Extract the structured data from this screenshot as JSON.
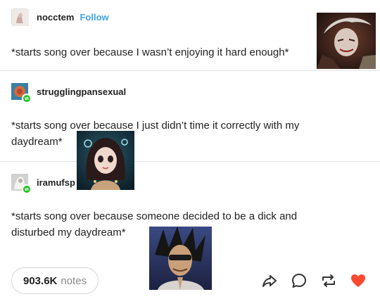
{
  "posts": [
    {
      "username": "nocctem",
      "follow_label": "Follow",
      "text": "*starts song over because I wasn’t enjoying it hard enough*"
    },
    {
      "username": "strugglingpansexual",
      "text": "*starts song over because I just didn’t time it correctly with my daydream*"
    },
    {
      "username": "iramufsp",
      "text": "*starts song over because someone decided to be a dick and disturbed my daydream*"
    }
  ],
  "footer": {
    "notes_count": "903.6K",
    "notes_label": "notes"
  },
  "colors": {
    "follow": "#3fa3e8",
    "reblog_badge": "#1ec31e",
    "heart": "#ff4930",
    "icon": "#333333"
  },
  "icons": [
    "share-icon",
    "reply-icon",
    "reblog-icon",
    "like-heart-icon"
  ]
}
